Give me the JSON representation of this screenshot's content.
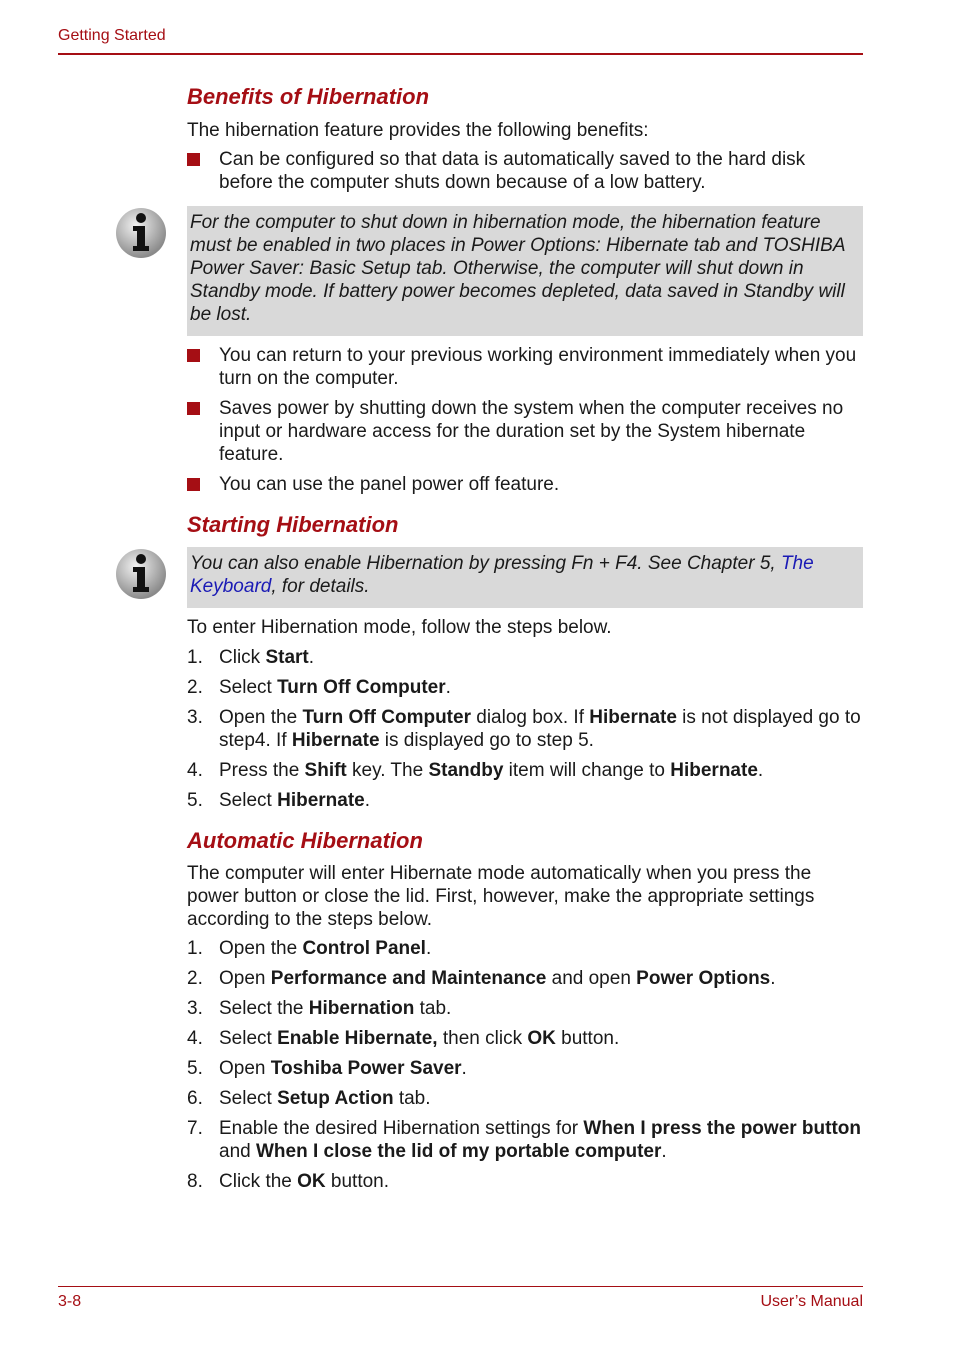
{
  "header": {
    "section": "Getting Started"
  },
  "footer": {
    "page_number": "3-8",
    "manual_title": "User’s Manual"
  },
  "colors": {
    "accent": "#a50e14",
    "note_bg": "#d9d9d9",
    "link": "#1a1ab5"
  },
  "benefits": {
    "heading": "Benefits of Hibernation",
    "intro": "The hibernation feature provides the following benefits:",
    "bullet1": "Can be configured so that data is automatically saved to the hard disk before the computer shuts down because of a low battery.",
    "note": {
      "icon": "info-icon",
      "text": "For the computer to shut down in hibernation mode, the hibernation feature must be enabled in two places in Power Options: Hibernate tab and TOSHIBA Power Saver: Basic Setup tab. Otherwise, the computer will shut down in Standby mode. If battery power becomes depleted, data saved in Standby will be lost."
    },
    "bullet2": "You can return to your previous working environment immediately when you turn on the computer.",
    "bullet3": "Saves power by shutting down the system when the computer receives no input or hardware access for the duration set by the System hibernate feature.",
    "bullet4": "You can use the panel power off feature."
  },
  "starting": {
    "heading": "Starting Hibernation",
    "note": {
      "icon": "info-icon",
      "text_before": "You can also enable Hibernation by pressing Fn + F4. See Chapter 5, ",
      "link": "The Keyboard",
      "text_after": ", for details."
    },
    "intro": "To enter Hibernation mode, follow the steps below.",
    "steps": {
      "s1": {
        "num": "1.",
        "t1": "Click ",
        "b1": "Start",
        "t2": "."
      },
      "s2": {
        "num": "2.",
        "t1": "Select ",
        "b1": "Turn Off Computer",
        "t2": "."
      },
      "s3": {
        "num": "3.",
        "t1": "Open the ",
        "b1": "Turn Off Computer",
        "t2": " dialog box. If ",
        "b2": "Hibernate",
        "t3": " is not displayed go to step4. If ",
        "b3": "Hibernate",
        "t4": " is displayed go to step 5."
      },
      "s4": {
        "num": "4.",
        "t1": "Press the ",
        "b1": "Shift",
        "t2": " key. The ",
        "b2": "Standby",
        "t3": " item will change to ",
        "b3": "Hibernate",
        "t4": "."
      },
      "s5": {
        "num": "5.",
        "t1": "Select ",
        "b1": "Hibernate",
        "t2": "."
      }
    }
  },
  "automatic": {
    "heading": "Automatic Hibernation",
    "intro": "The computer will enter Hibernate mode automatically when you press the power button or close the lid. First, however, make the appropriate settings according to the steps below.",
    "steps": {
      "s1": {
        "num": "1.",
        "t1": "Open the ",
        "b1": "Control Panel",
        "t2": "."
      },
      "s2": {
        "num": "2.",
        "t1": "Open ",
        "b1": "Performance and Maintenance",
        "t2": " and open ",
        "b2": "Power Options",
        "t3": "."
      },
      "s3": {
        "num": "3.",
        "t1": "Select the ",
        "b1": "Hibernation",
        "t2": " tab."
      },
      "s4": {
        "num": "4.",
        "t1": "Select ",
        "b1": "Enable Hibernate,",
        "t2": " then click ",
        "b2": "OK",
        "t3": " button."
      },
      "s5": {
        "num": "5.",
        "t1": "Open ",
        "b1": "Toshiba Power Saver",
        "t2": "."
      },
      "s6": {
        "num": "6.",
        "t1": "Select ",
        "b1": "Setup Action",
        "t2": " tab."
      },
      "s7": {
        "num": "7.",
        "t1": "Enable the desired Hibernation settings for ",
        "b1": "When I press the power button",
        "t2": " and ",
        "b2": "When I close the lid of my portable computer",
        "t3": "."
      },
      "s8": {
        "num": "8.",
        "t1": "Click the ",
        "b1": "OK",
        "t2": " button."
      }
    }
  }
}
